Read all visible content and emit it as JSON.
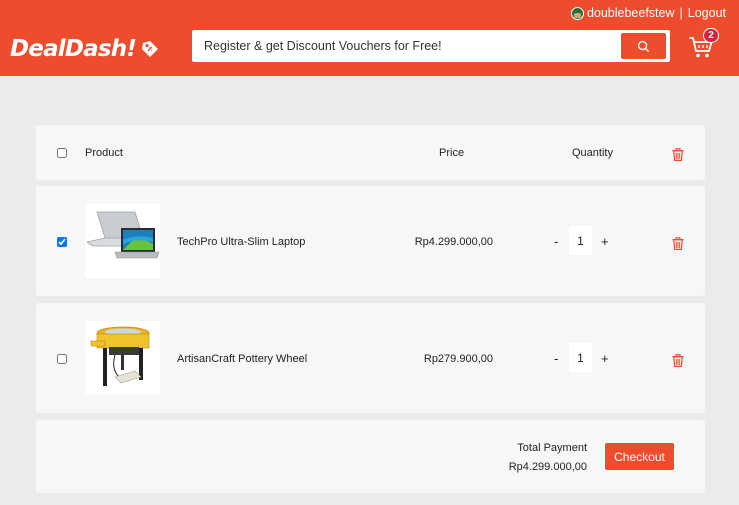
{
  "app": {
    "brand": "DealDash!",
    "username": "doublebeefstew",
    "separator": "|",
    "logout_label": "Logout",
    "accent_color": "#ee4d2d"
  },
  "search": {
    "placeholder": "Register & get Discount Vouchers for Free!",
    "icon": "search-icon"
  },
  "cart": {
    "icon": "cart-icon",
    "count": "2"
  },
  "table_header": {
    "product": "Product",
    "price": "Price",
    "quantity": "Quantity",
    "select_all_checked": false
  },
  "items": [
    {
      "name": "TechPro Ultra-Slim Laptop",
      "price": "Rp4.299.000,00",
      "quantity": "1",
      "checked": true,
      "minus": "-",
      "plus": "+",
      "image": "laptop"
    },
    {
      "name": "ArtisanCraft Pottery Wheel",
      "price": "Rp279.900,00",
      "quantity": "1",
      "checked": false,
      "minus": "-",
      "plus": "+",
      "image": "pottery-wheel"
    }
  ],
  "footer": {
    "total_label": "Total Payment",
    "total_value": "Rp4.299.000,00",
    "checkout_label": "Checkout"
  }
}
